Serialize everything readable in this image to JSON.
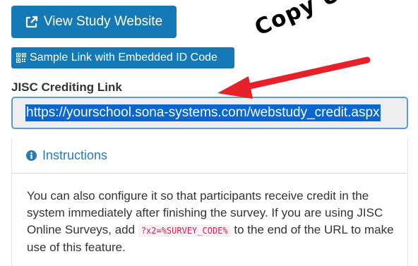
{
  "buttons": {
    "view_study_website": "View Study Website",
    "sample_link": "Sample Link with Embedded ID Code"
  },
  "crediting": {
    "label": "JISC Crediting Link",
    "value": "https://yourschool.sona-systems.com/webstudy_credit.aspx"
  },
  "annotation": {
    "text": "Copy URL",
    "color": "#e8202a"
  },
  "instructions": {
    "heading": "Instructions",
    "body_before": "You can also configure it so that participants receive credit in the system immediately after finishing the survey. If you are using JISC Online Surveys, add ",
    "code": "?x2=%SURVEY_CODE%",
    "body_after": " to the end of the URL to make use of this feature."
  },
  "icons": {
    "external_link": "external-link-icon",
    "qrcode": "qrcode-icon",
    "info": "info-circle-icon"
  },
  "colors": {
    "button_blue": "#1579b8",
    "link_blue": "#2a7ab8",
    "selection_blue": "#0a66d0",
    "code_red": "#c7254e"
  }
}
